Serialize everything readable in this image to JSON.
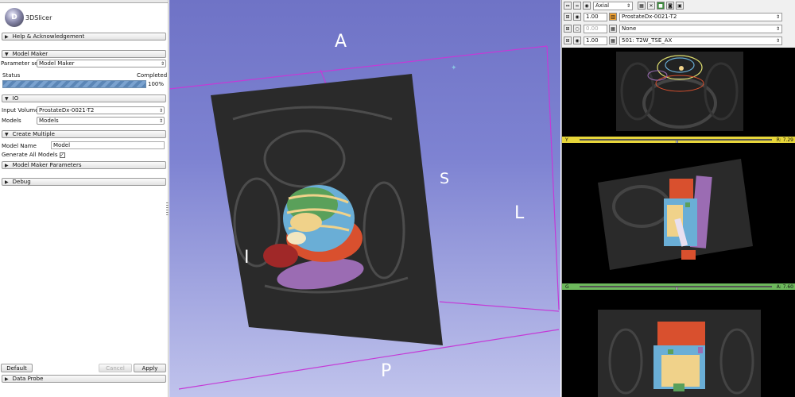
{
  "app": {
    "logo_text": "3DSlicer",
    "logo_mark": "D"
  },
  "sections": {
    "help": "Help & Acknowledgement",
    "model_maker": "Model Maker",
    "io": "IO",
    "create_multiple": "Create Multiple",
    "params": "Model Maker Parameters",
    "debug": "Debug",
    "data_probe": "Data Probe"
  },
  "model_maker": {
    "parameter_set_label": "Parameter set:",
    "parameter_set_value": "Model Maker",
    "status_label": "Status",
    "status_value": "Completed",
    "progress_percent": 100,
    "progress_text": "100%"
  },
  "io": {
    "input_volume_label": "Input Volume",
    "input_volume_value": "ProstateDx-0021-T2",
    "models_label": "Models",
    "models_value": "Models"
  },
  "create_multiple": {
    "model_name_label": "Model Name",
    "model_name_value": "Model",
    "generate_all_label": "Generate All Models",
    "generate_all_checked": "✓"
  },
  "buttons": {
    "default": "Default",
    "cancel": "Cancel",
    "apply": "Apply"
  },
  "view3d": {
    "labels": {
      "anterior": "A",
      "posterior": "P",
      "superior": "S",
      "inferior": "I",
      "left": "L"
    }
  },
  "slice_controls": {
    "orientation": "Axial",
    "fg_opacity": "1.00",
    "fg_volume": "ProstateDx-0021-T2",
    "bg_opacity": "0.00",
    "bg_volume": "None",
    "label_opacity": "1.00",
    "label_volume": "501: T2W_TSE_AX"
  },
  "slices": {
    "yellow": {
      "label": "Y",
      "value": "R: 7.29",
      "color": "#e7d63a",
      "position": 0.5
    },
    "green": {
      "label": "G",
      "value": "A: 7.60",
      "color": "#6db85c",
      "position": 0.5
    }
  },
  "colors": {
    "bg3d_top": "#6f73c6",
    "bounding_box": "#c43ad6",
    "red_seg": "#d9502e",
    "purple_seg": "#9b6cb3",
    "blue_seg": "#6aaed6",
    "yellow_seg": "#f0d28a",
    "green_seg": "#5aa05a"
  }
}
